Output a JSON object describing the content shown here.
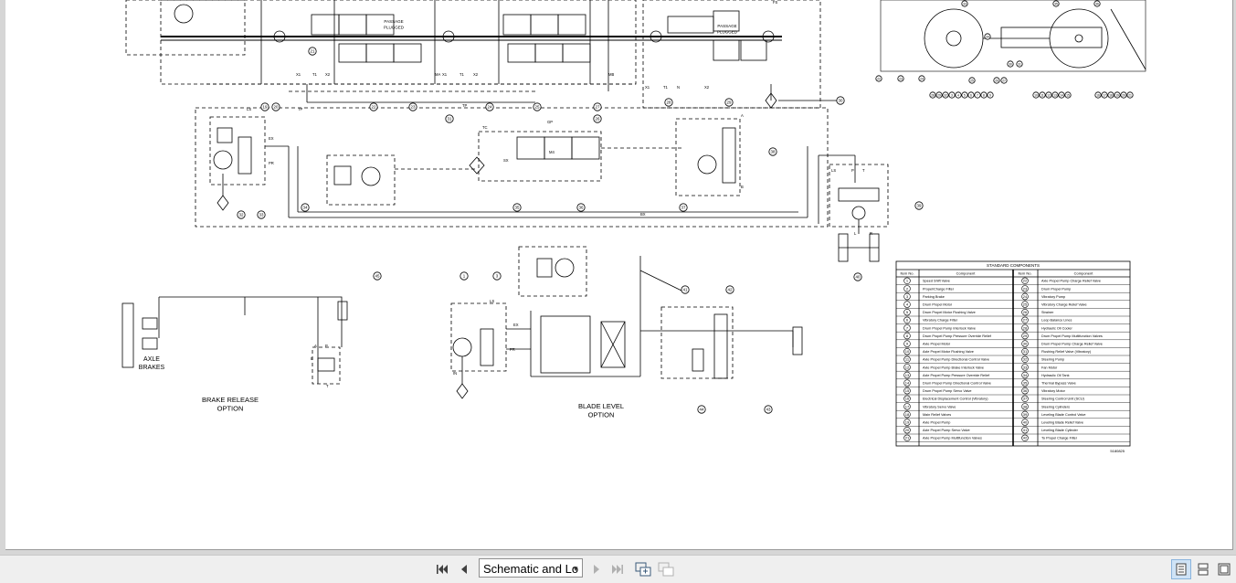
{
  "diagram": {
    "labels": {
      "passage_plugged_1": "PASSAGE\nPLUGGED",
      "passage_plugged_2": "PASSAGE\nPLUGGED",
      "axle_brakes": "AXLE\nBRAKES",
      "brake_release": "BRAKE RELEASE\nOPTION",
      "blade_level": "BLADE LEVEL\nOPTION",
      "drawing_number": "5180825"
    },
    "ports": [
      "LS",
      "EX",
      "PR",
      "TP",
      "TP",
      "X1",
      "T1",
      "X2",
      "X1",
      "T1",
      "X2",
      "MA",
      "MB",
      "A",
      "B",
      "P",
      "T",
      "LS",
      "FS",
      "X1",
      "T1",
      "N",
      "X2",
      "BX",
      "SX",
      "TC",
      "M4",
      "GP",
      "L",
      "R",
      "LS",
      "EX",
      "PR",
      "IN",
      "B",
      "A",
      "P",
      "T"
    ],
    "callouts": [
      "19",
      "20",
      "21",
      "22",
      "23",
      "24",
      "25",
      "26",
      "27",
      "28",
      "29",
      "30",
      "31",
      "32",
      "33",
      "34",
      "35",
      "36",
      "37",
      "38",
      "39",
      "40",
      "41",
      "42",
      "43",
      "44",
      "45",
      "1",
      "3"
    ],
    "machine_callouts": [
      "28",
      "29",
      "32",
      "3",
      "4",
      "5",
      "6",
      "7",
      "8",
      "9",
      "10",
      "11",
      "12",
      "13",
      "14",
      "15",
      "16",
      "17",
      "18",
      "19",
      "20",
      "21",
      "22",
      "23",
      "24",
      "25",
      "26",
      "27",
      "30",
      "31",
      "33",
      "34",
      "35",
      "36"
    ]
  },
  "components_table": {
    "title": "STANDARD COMPONENTS",
    "headers": [
      "Item No.",
      "Component",
      "Item No.",
      "Component"
    ],
    "rows": [
      [
        "1",
        "Speed Shift Valve",
        "22",
        "Axle Propel Pump Charge Relief Valve"
      ],
      [
        "2",
        "Propel/Charge Filter",
        "23",
        "Drum Propel Pump"
      ],
      [
        "3",
        "Parking Brake",
        "24",
        "Vibratory Pump"
      ],
      [
        "4",
        "Drum Propel Motor",
        "25",
        "Vibratory Charge Relief Valve"
      ],
      [
        "5",
        "Drum Propel Motor Flushing Valve",
        "26",
        "Strainer"
      ],
      [
        "6",
        "Vibratory Charge Filter",
        "27",
        "Loop Balance Lines"
      ],
      [
        "7",
        "Drum Propel Pump Interlock Valve",
        "28",
        "Hydraulic Oil Cooler"
      ],
      [
        "8",
        "Drum Propel Pump Pressure Override Relief",
        "29",
        "Drum Propel Pump Multifunction Valves"
      ],
      [
        "9",
        "Axle Propel Motor",
        "30",
        "Drum Propel Pump Charge Relief Valve"
      ],
      [
        "10",
        "Axle Propel Motor Flushing Valve",
        "31",
        "Flushing Relief Valve (Vibratory)"
      ],
      [
        "11",
        "Axle Propel Pump Directional Control Valve",
        "32",
        "Steering Pump"
      ],
      [
        "12",
        "Axle Propel Pump Brake Interlock Valve",
        "33",
        "Fan Motor"
      ],
      [
        "13",
        "Axle Propel Pump Pressure Override Relief",
        "34",
        "Hydraulic Oil Tank"
      ],
      [
        "14",
        "Drum Propel Pump Directional Control Valve",
        "35",
        "Thermal Bypass Valve"
      ],
      [
        "15",
        "Drum Propel Pump Servo Valve",
        "36",
        "Vibratory Motor"
      ],
      [
        "16",
        "Electrical Displacement Control (Vibratory)",
        "37",
        "Steering Control Unit (SCU)"
      ],
      [
        "17",
        "Vibratory Servo Valve",
        "38",
        "Steering Cylinders"
      ],
      [
        "18",
        "Main Relief Valves",
        "39",
        "Leveling Blade Control Valve"
      ],
      [
        "19",
        "Axle Propel Pump",
        "40",
        "Leveling Blade Relief Valve"
      ],
      [
        "20",
        "Axle Propel Pump Servo Valve",
        "41",
        "Leveling Blade Cylinder"
      ],
      [
        "21",
        "Axle Propel Pump Multifunction Valves",
        "42",
        "To Propel Charge Filter"
      ]
    ]
  },
  "toolbar": {
    "sheet_name": "Schematic and Lo",
    "first_page_icon": "first-page-icon",
    "prev_page_icon": "previous-page-icon",
    "next_page_icon": "next-page-icon",
    "last_page_icon": "last-page-icon",
    "insert_page_icon": "insert-page-icon",
    "delete_page_icon": "delete-page-icon",
    "single_page_icon": "single-page-view-icon",
    "two_page_icon": "two-page-view-icon",
    "fit_icon": "fit-view-icon"
  },
  "colors": {
    "page": "#ffffff",
    "background": "#d6d6d6",
    "toolbar": "#efefef",
    "ink": "#000000",
    "active_view": "#cfe3f6"
  }
}
